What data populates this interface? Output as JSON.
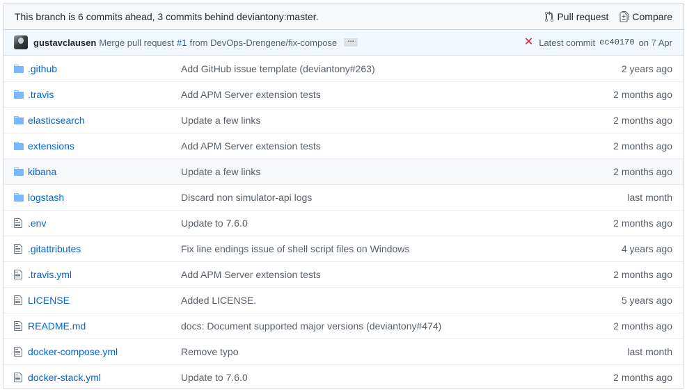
{
  "branch_bar": {
    "text": "This branch is 6 commits ahead, 3 commits behind deviantony:master.",
    "pull_request_label": "Pull request",
    "compare_label": "Compare",
    "pull_request_icon": "git-pull-request-icon",
    "compare_icon": "file-diff-icon"
  },
  "latest_commit": {
    "author": "gustavclausen",
    "message_prefix": "Merge pull request",
    "pr_number": "#1",
    "message_suffix": "from DevOps-Drengene/fix-compose",
    "ellipsis": "…",
    "status_icon": "x-icon",
    "status_color": "#cb2431",
    "label": "Latest commit",
    "sha": "ec40170",
    "date": "on 7 Apr"
  },
  "colors": {
    "link": "#0366d6",
    "muted": "#586069",
    "folder_icon": "#79b8ff",
    "file_icon": "#6a737d"
  },
  "files": [
    {
      "type": "dir",
      "name": ".github",
      "message": "Add GitHub issue template (deviantony#263)",
      "age": "2 years ago"
    },
    {
      "type": "dir",
      "name": ".travis",
      "message": "Add APM Server extension tests",
      "age": "2 months ago"
    },
    {
      "type": "dir",
      "name": "elasticsearch",
      "message": "Update a few links",
      "age": "2 months ago"
    },
    {
      "type": "dir",
      "name": "extensions",
      "message": "Add APM Server extension tests",
      "age": "2 months ago"
    },
    {
      "type": "dir",
      "name": "kibana",
      "message": "Update a few links",
      "age": "2 months ago"
    },
    {
      "type": "dir",
      "name": "logstash",
      "message": "Discard non simulator-api logs",
      "age": "last month"
    },
    {
      "type": "file",
      "name": ".env",
      "message": "Update to 7.6.0",
      "age": "2 months ago"
    },
    {
      "type": "file",
      "name": ".gitattributes",
      "message": "Fix line endings issue of shell script files on Windows",
      "age": "4 years ago"
    },
    {
      "type": "file",
      "name": ".travis.yml",
      "message": "Add APM Server extension tests",
      "age": "2 months ago"
    },
    {
      "type": "file",
      "name": "LICENSE",
      "message": "Added LICENSE.",
      "age": "5 years ago"
    },
    {
      "type": "file",
      "name": "README.md",
      "message": "docs: Document supported major versions (deviantony#474)",
      "age": "2 months ago"
    },
    {
      "type": "file",
      "name": "docker-compose.yml",
      "message": "Remove typo",
      "age": "last month"
    },
    {
      "type": "file",
      "name": "docker-stack.yml",
      "message": "Update to 7.6.0",
      "age": "2 months ago"
    }
  ]
}
